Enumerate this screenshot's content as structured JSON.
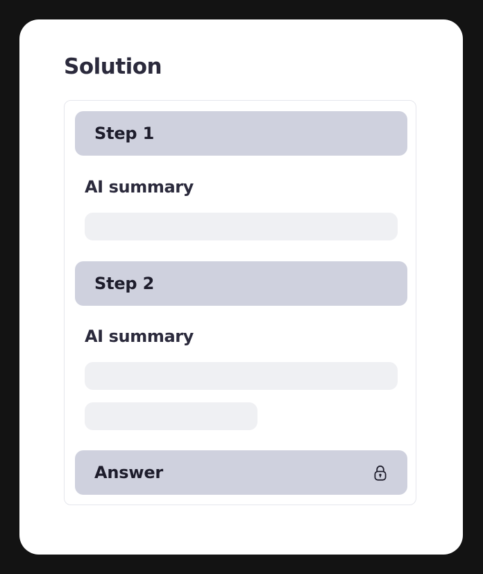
{
  "page": {
    "title": "Solution"
  },
  "solution": {
    "steps": [
      {
        "label": "Step 1",
        "summary_label": "AI summary",
        "placeholder_lines": 1
      },
      {
        "label": "Step 2",
        "summary_label": "AI summary",
        "placeholder_lines": 2
      }
    ],
    "answer": {
      "label": "Answer",
      "icon": "lock-icon",
      "locked": true
    }
  },
  "colors": {
    "frame": "#131313",
    "screen": "#ffffff",
    "header_background": "#cfd1de",
    "placeholder": "#eff0f3",
    "text": "#2b2a3c"
  }
}
